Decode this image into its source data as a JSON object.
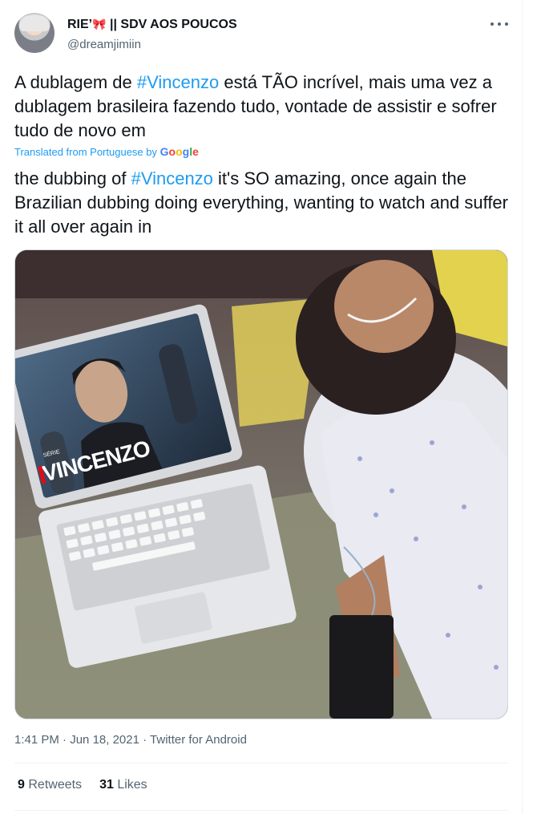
{
  "author": {
    "display_name": "RIE’",
    "display_name_suffix": "|| SDV AOS POUCOS",
    "bow_emoji": "🎀",
    "handle": "@dreamjimiin"
  },
  "tweet": {
    "original_before": "A dublagem de ",
    "original_hashtag": "#Vincenzo",
    "original_after": " está  TÃO  incrível, mais uma vez a dublagem brasileira fazendo tudo, vontade de assistir e sofrer tudo de novo em",
    "translated_from": "Translated from Portuguese by ",
    "google_letters": [
      "G",
      "o",
      "o",
      "g",
      "l",
      "e"
    ],
    "translation_before": "the dubbing of ",
    "translation_hashtag": "#Vincenzo",
    "translation_after": " it's SO amazing, once again the Brazilian dubbing doing everything, wanting to watch and suffer it all over again in"
  },
  "media": {
    "screen_small_text": "SÉRIE",
    "screen_title": "VINCENZO"
  },
  "meta": {
    "time": "1:41 PM",
    "date": "Jun 18, 2021",
    "source": "Twitter for Android",
    "separator": "·"
  },
  "stats": {
    "retweets_count": "9",
    "retweets_label": "Retweets",
    "likes_count": "31",
    "likes_label": "Likes"
  },
  "colors": {
    "link": "#1d9bf0",
    "text": "#0f1419",
    "secondary": "#536471",
    "netflix_red": "#e50914"
  }
}
